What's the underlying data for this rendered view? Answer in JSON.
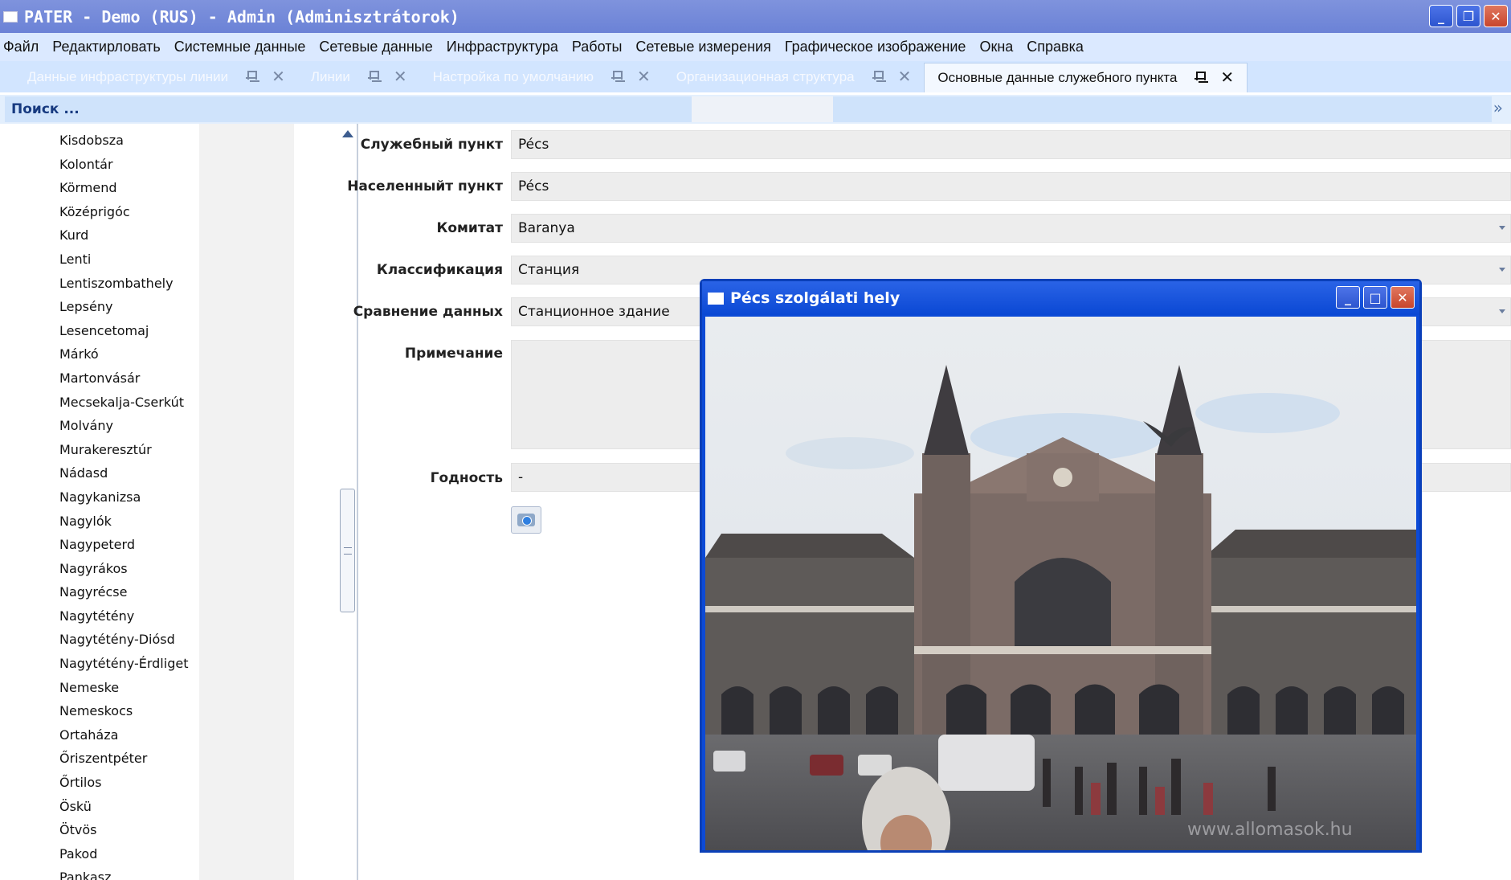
{
  "window": {
    "title": "PATER - Demo (RUS) - Admin (Adminisztrátorok)",
    "minimize": "_",
    "restore": "❐",
    "close": "✕"
  },
  "menu": [
    "Файл",
    "Редактирловать",
    "Системные данные",
    "Сетевые данные",
    "Инфраструктура",
    "Работы",
    "Сетевые измерения",
    "Графическое изображение",
    "Окна",
    "Справка"
  ],
  "tabs": [
    {
      "label": "Данные инфраструктуры линии",
      "active": false
    },
    {
      "label": "Линии",
      "active": false
    },
    {
      "label": "Настройка по умолчанию",
      "active": false
    },
    {
      "label": "Организационная структура",
      "active": false
    },
    {
      "label": "Основные данные служебного пункта",
      "active": true
    }
  ],
  "search": {
    "placeholder": "Поиск ..."
  },
  "list_items": [
    "Kisdobsza",
    "Kolontár",
    "Körmend",
    "Középrigóc",
    "Kurd",
    "Lenti",
    "Lentiszombathely",
    "Lepsény",
    "Lesencetomaj",
    "Márkó",
    "Martonvásár",
    "Mecsekalja-Cserkút",
    "Molvány",
    "Murakeresztúr",
    "Nádasd",
    "Nagykanizsa",
    "Nagylók",
    "Nagypeterd",
    "Nagyrákos",
    "Nagyrécse",
    "Nagytétény",
    "Nagytétény-Diósd",
    "Nagytétény-Érdliget",
    "Nemeske",
    "Nemeskocs",
    "Ortaháza",
    "Őriszentpéter",
    "Őrtilos",
    "Öskü",
    "Ötvös",
    "Pakod",
    "Pankasz"
  ],
  "form": {
    "service_point": {
      "label": "Служебный пункт",
      "value": "Pécs"
    },
    "settlement": {
      "label": "Населенныйт пункт",
      "value": "Pécs"
    },
    "county": {
      "label": "Комитат",
      "value": "Baranya"
    },
    "classification": {
      "label": "Классификация",
      "value": "Станция"
    },
    "data_comparison": {
      "label": "Сравнение данных",
      "value": "Станционное здание"
    },
    "note": {
      "label": "Примечание",
      "value": ""
    },
    "validity": {
      "label": "Годность",
      "value": "-"
    }
  },
  "photo_window": {
    "title": "Pécs szolgálati hely",
    "watermark": "www.allomasok.hu",
    "minimize": "_",
    "maximize": "□",
    "close": "✕"
  }
}
